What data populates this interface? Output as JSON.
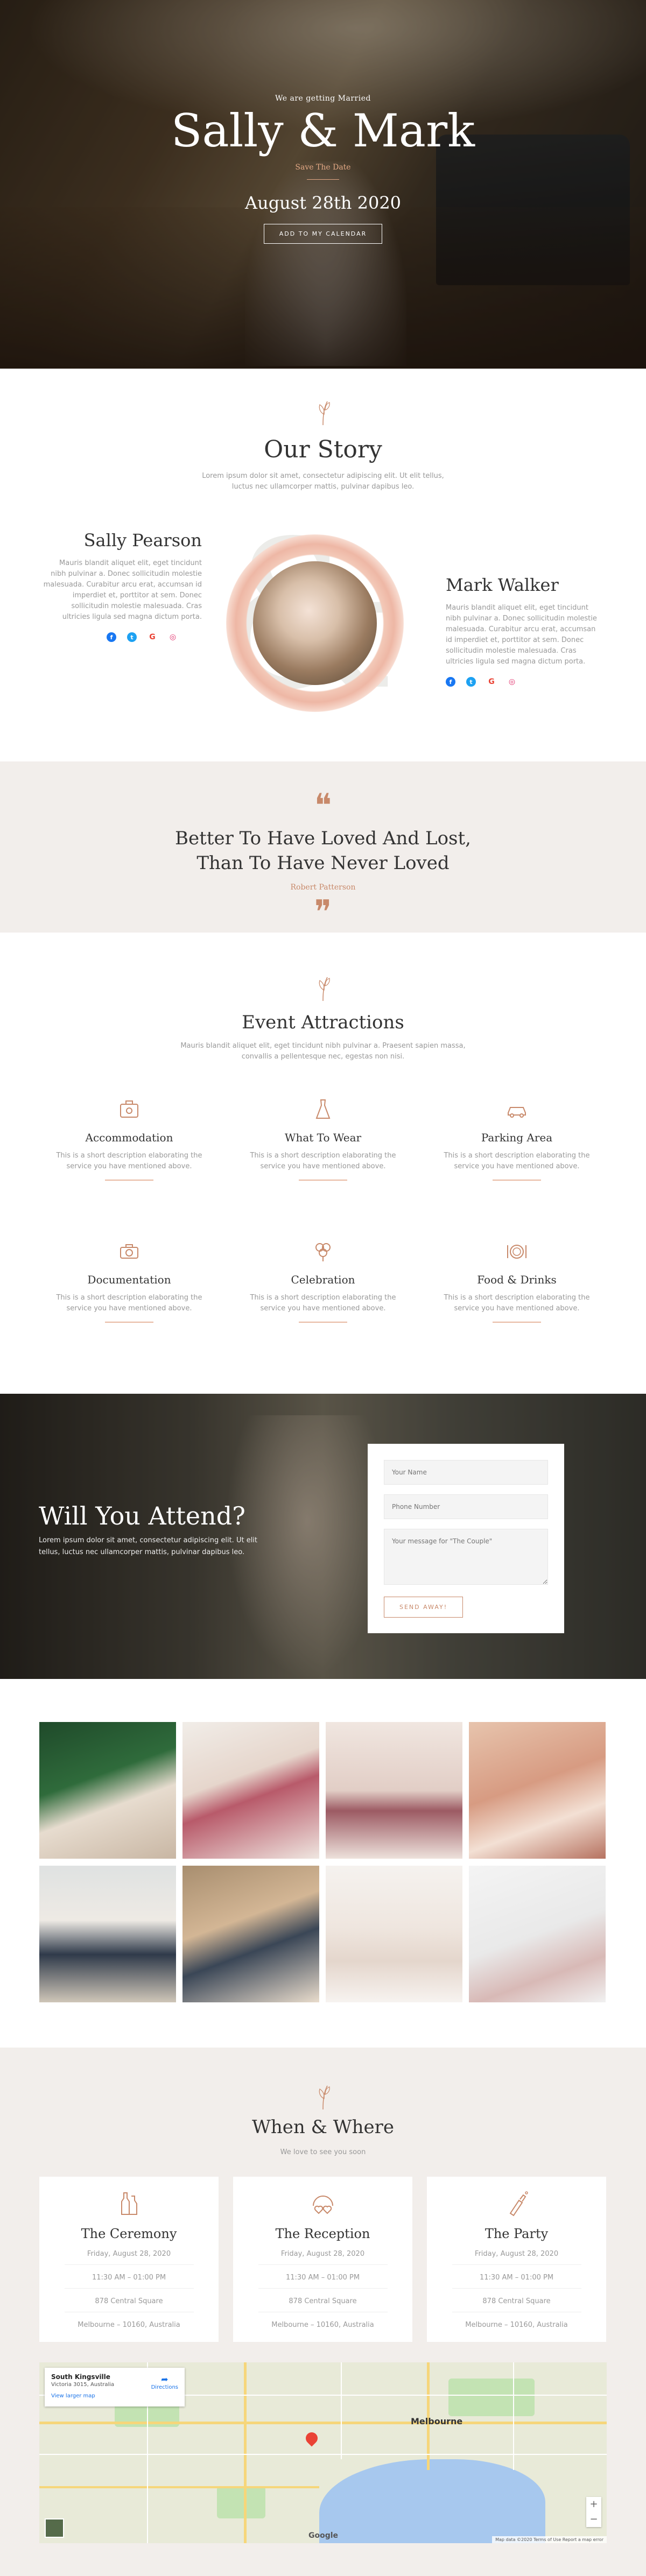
{
  "hero": {
    "pre": "We are getting Married",
    "names": "Sally & Mark",
    "save_date": "Save The Date",
    "date": "August 28th 2020",
    "calendar_button": "ADD TO MY CALENDAR"
  },
  "story": {
    "title": "Our Story",
    "subtitle_line1": "Lorem ipsum dolor sit amet, consectetur adipiscing elit. Ut elit tellus,",
    "subtitle_line2": "luctus nec ullamcorper mattis, pulvinar dapibus leo.",
    "bride": {
      "name": "Sally Pearson",
      "bio": "Mauris blandit aliquet elit, eget tincidunt nibh pulvinar a. Donec sollicitudin molestie malesuada. Curabitur arcu erat, accumsan id imperdiet et, porttitor at sem. Donec sollicitudin molestie malesuada. Cras ultricies ligula sed magna dictum porta."
    },
    "groom": {
      "name": "Mark Walker",
      "bio": "Mauris blandit aliquet elit, eget tincidunt nibh pulvinar a. Donec sollicitudin molestie malesuada. Curabitur arcu erat, accumsan id imperdiet et, porttitor at sem. Donec sollicitudin molestie malesuada. Cras ultricies ligula sed magna dictum porta."
    },
    "social_glyphs": {
      "facebook": "f",
      "twitter": "t",
      "google": "G",
      "instagram": "◎"
    },
    "ampersand": "&"
  },
  "quote": {
    "open_mark": "❝",
    "close_mark": "❞",
    "line1": "Better To Have Loved And Lost,",
    "line2": "Than To Have Never Loved",
    "author": "Robert Patterson"
  },
  "events": {
    "title": "Event Attractions",
    "subtitle_line1": "Mauris blandit aliquet elit, eget tincidunt nibh pulvinar a. Praesent sapien massa,",
    "subtitle_line2": "convallis a pellentesque nec, egestas non nisi.",
    "items": [
      {
        "title": "Accommodation",
        "desc1": "This is a short description elaborating the",
        "desc2": "service you have mentioned above."
      },
      {
        "title": "What To Wear",
        "desc1": "This is a short description elaborating the",
        "desc2": "service you have mentioned above."
      },
      {
        "title": "Parking Area",
        "desc1": "This is a short description elaborating the",
        "desc2": "service you have mentioned above."
      },
      {
        "title": "Documentation",
        "desc1": "This is a short description elaborating the",
        "desc2": "service you have mentioned above."
      },
      {
        "title": "Celebration",
        "desc1": "This is a short description elaborating the",
        "desc2": "service you have mentioned above."
      },
      {
        "title": "Food & Drinks",
        "desc1": "This is a short description elaborating the",
        "desc2": "service you have mentioned above."
      }
    ]
  },
  "rsvp": {
    "title": "Will You Attend?",
    "lead": "Lorem ipsum dolor sit amet, consectetur adipiscing elit. Ut elit tellus, luctus nec ullamcorper mattis, pulvinar dapibus leo.",
    "name_placeholder": "Your Name",
    "phone_placeholder": "Phone Number",
    "message_placeholder": "Your message for \"The Couple\"",
    "send_button": "SEND AWAY!"
  },
  "when": {
    "title": "When & Where",
    "subtitle": "We love to see you soon",
    "cards": [
      {
        "title": "The Ceremony",
        "date": "Friday, August 28, 2020",
        "time": "11:30 AM – 01:00 PM",
        "place": "878 Central Square",
        "city": "Melbourne – 10160, Australia"
      },
      {
        "title": "The Reception",
        "date": "Friday, August 28, 2020",
        "time": "11:30 AM – 01:00 PM",
        "place": "878 Central Square",
        "city": "Melbourne – 10160, Australia"
      },
      {
        "title": "The Party",
        "date": "Friday, August 28, 2020",
        "time": "11:30 AM – 01:00 PM",
        "place": "878 Central Square",
        "city": "Melbourne – 10160, Australia"
      }
    ]
  },
  "map": {
    "place_title": "South Kingsville",
    "place_sub": "Victoria 3015, Australia",
    "larger_map": "View larger map",
    "directions": "Directions",
    "city_label": "Melbourne",
    "google": "Google",
    "attribution": "Map data ©2020   Terms of Use   Report a map error",
    "zoom_in": "+",
    "zoom_out": "−"
  },
  "colors": {
    "accent": "#c8896a",
    "beige": "#f2eeeb",
    "facebook": "#1877f2",
    "twitter": "#1da1f2",
    "google": "#ea4335",
    "instagram": "#e1306c"
  }
}
